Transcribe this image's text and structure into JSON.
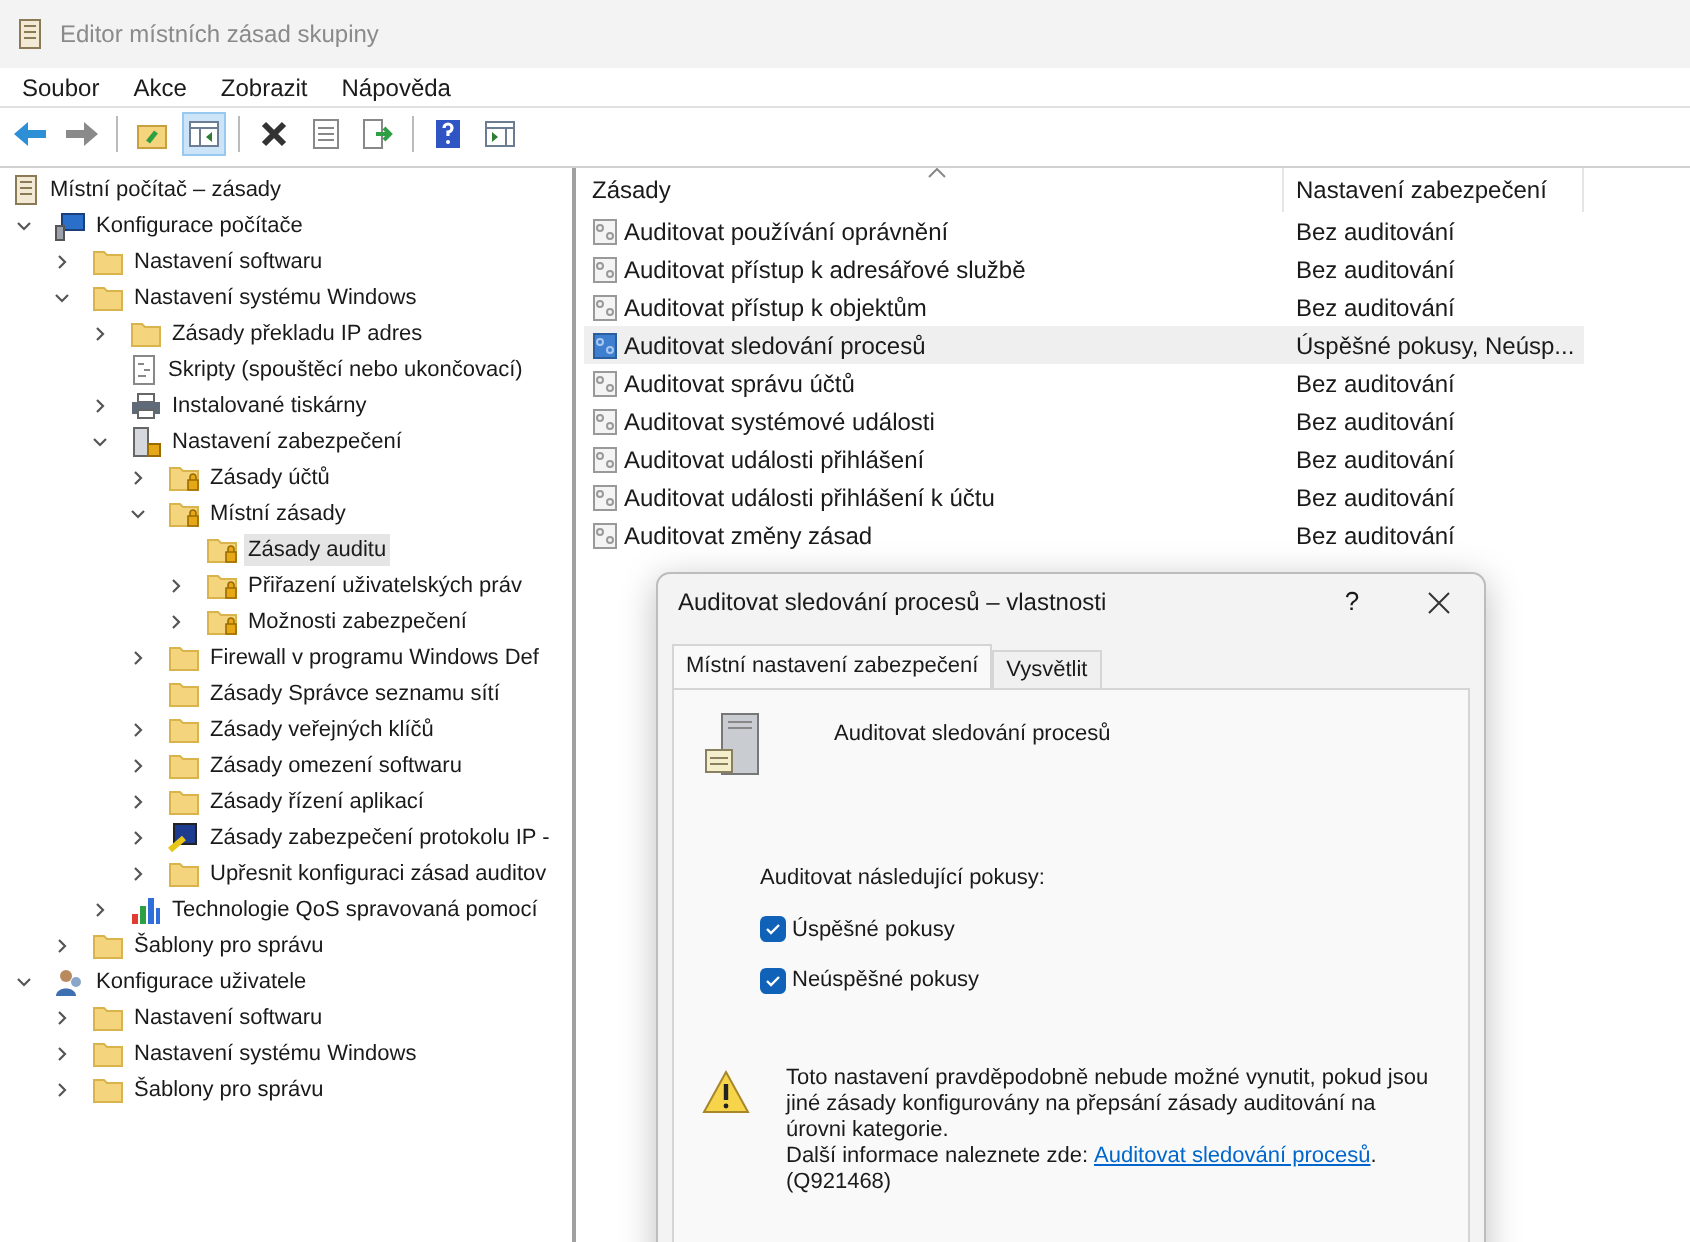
{
  "window": {
    "title": "Editor místních zásad skupiny"
  },
  "menu": [
    "Soubor",
    "Akce",
    "Zobrazit",
    "Nápověda"
  ],
  "toolbar": [
    [
      {
        "kind": "back",
        "pressed": false
      },
      {
        "kind": "forward",
        "pressed": false
      }
    ],
    [
      {
        "kind": "up",
        "pressed": false
      },
      {
        "kind": "tree",
        "pressed": true
      }
    ],
    [
      {
        "kind": "delete",
        "pressed": false
      },
      {
        "kind": "properties",
        "pressed": false
      },
      {
        "kind": "export",
        "pressed": false
      }
    ],
    [
      {
        "kind": "help",
        "pressed": false
      },
      {
        "kind": "view",
        "pressed": false
      }
    ]
  ],
  "tree": [
    {
      "label": "Místní počítač – zásady",
      "kind": "scroll",
      "selected": false,
      "children": [
        {
          "label": "Konfigurace počítače",
          "kind": "computer",
          "expanded": true,
          "selected": false,
          "children": [
            {
              "label": "Nastavení softwaru",
              "kind": "folder",
              "expanded": false,
              "selected": false
            },
            {
              "label": "Nastavení systému Windows",
              "kind": "folder",
              "expanded": true,
              "selected": false,
              "children": [
                {
                  "label": "Zásady překladu IP adres",
                  "kind": "folder",
                  "expanded": false,
                  "selected": false
                },
                {
                  "label": "Skripty (spouštěcí nebo ukončovací)",
                  "kind": "script",
                  "selected": false
                },
                {
                  "label": "Instalované tiskárny",
                  "kind": "printer",
                  "expanded": false,
                  "selected": false
                },
                {
                  "label": "Nastavení zabezpečení",
                  "kind": "security",
                  "expanded": true,
                  "selected": false,
                  "children": [
                    {
                      "label": "Zásady účtů",
                      "kind": "lockfolder",
                      "expanded": false,
                      "selected": false
                    },
                    {
                      "label": "Místní zásady",
                      "kind": "lockfolder",
                      "expanded": true,
                      "selected": false,
                      "children": [
                        {
                          "label": "Zásady auditu",
                          "kind": "lockfolder",
                          "selected": true
                        },
                        {
                          "label": "Přiřazení uživatelských práv",
                          "kind": "lockfolder",
                          "expanded": false,
                          "selected": false
                        },
                        {
                          "label": "Možnosti zabezpečení",
                          "kind": "lockfolder",
                          "expanded": false,
                          "selected": false
                        }
                      ]
                    },
                    {
                      "label": "Firewall v programu Windows Def",
                      "kind": "folder",
                      "expanded": false,
                      "selected": false
                    },
                    {
                      "label": "Zásady Správce seznamu sítí",
                      "kind": "folder",
                      "selected": false
                    },
                    {
                      "label": "Zásady veřejných klíčů",
                      "kind": "folder",
                      "expanded": false,
                      "selected": false
                    },
                    {
                      "label": "Zásady omezení softwaru",
                      "kind": "folder",
                      "expanded": false,
                      "selected": false
                    },
                    {
                      "label": "Zásady řízení aplikací",
                      "kind": "folder",
                      "expanded": false,
                      "selected": false
                    },
                    {
                      "label": "Zásady zabezpečení protokolu IP -",
                      "kind": "ipsec",
                      "expanded": false,
                      "selected": false
                    },
                    {
                      "label": "Upřesnit konfiguraci zásad auditov",
                      "kind": "folder",
                      "expanded": false,
                      "selected": false
                    }
                  ]
                },
                {
                  "label": "Technologie QoS spravovaná pomocí",
                  "kind": "chart",
                  "expanded": false,
                  "selected": false
                }
              ]
            },
            {
              "label": "Šablony pro správu",
              "kind": "folder",
              "expanded": false,
              "selected": false
            }
          ]
        },
        {
          "label": "Konfigurace uživatele",
          "kind": "user",
          "expanded": true,
          "selected": false,
          "children": [
            {
              "label": "Nastavení softwaru",
              "kind": "folder",
              "expanded": false,
              "selected": false
            },
            {
              "label": "Nastavení systému Windows",
              "kind": "folder",
              "expanded": false,
              "selected": false
            },
            {
              "label": "Šablony pro správu",
              "kind": "folder",
              "expanded": false,
              "selected": false
            }
          ]
        }
      ]
    }
  ],
  "table": {
    "columns": [
      "Zásady",
      "Nastavení zabezpečení"
    ],
    "rows": [
      {
        "policy": "Auditovat používání oprávnění",
        "setting": "Bez auditování",
        "kind": "default",
        "selected": false
      },
      {
        "policy": "Auditovat přístup k adresářové službě",
        "setting": "Bez auditování",
        "kind": "default",
        "selected": false
      },
      {
        "policy": "Auditovat přístup k objektům",
        "setting": "Bez auditování",
        "kind": "default",
        "selected": false
      },
      {
        "policy": "Auditovat sledování procesů",
        "setting": "Úspěšné pokusy, Neúsp...",
        "kind": "configured",
        "selected": true
      },
      {
        "policy": "Auditovat správu účtů",
        "setting": "Bez auditování",
        "kind": "default",
        "selected": false
      },
      {
        "policy": "Auditovat systémové události",
        "setting": "Bez auditování",
        "kind": "default",
        "selected": false
      },
      {
        "policy": "Auditovat události přihlášení",
        "setting": "Bez auditování",
        "kind": "default",
        "selected": false
      },
      {
        "policy": "Auditovat události přihlášení k účtu",
        "setting": "Bez auditování",
        "kind": "default",
        "selected": false
      },
      {
        "policy": "Auditovat změny zásad",
        "setting": "Bez auditování",
        "kind": "default",
        "selected": false
      }
    ]
  },
  "dialog": {
    "title": "Auditovat sledování procesů – vlastnosti",
    "help": "?",
    "tabs": [
      {
        "label": "Místní nastavení zabezpečení",
        "selected": true
      },
      {
        "label": "Vysvětlit",
        "selected": false
      }
    ],
    "heading": "Auditovat sledování procesů",
    "group_label": "Auditovat následující pokusy:",
    "checkboxes": [
      {
        "label": "Úspěšné pokusy",
        "checked": true
      },
      {
        "label": "Neúspěšné pokusy",
        "checked": true
      }
    ],
    "warning": {
      "text": "Toto nastavení pravděpodobně nebude možné vynutit, pokud jsou jiné zásady konfigurovány na přepsání zásady auditování na úrovni kategorie.",
      "more": "Další informace naleznete zde:",
      "link": "Auditovat sledování procesů",
      "after_link": ".",
      "code": "(Q921468)"
    }
  }
}
